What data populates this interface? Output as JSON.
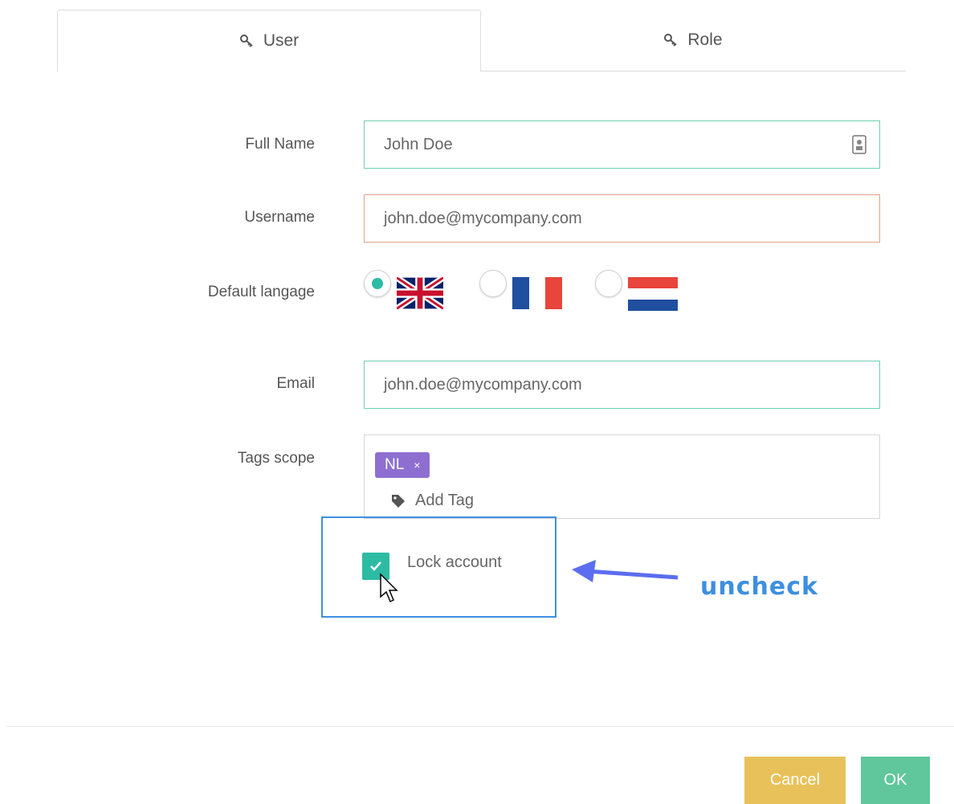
{
  "tabs": {
    "user": "User",
    "role": "Role"
  },
  "form": {
    "full_name_label": "Full Name",
    "full_name_value": "John Doe",
    "username_label": "Username",
    "username_value": "john.doe@mycompany.com",
    "language_label": "Default langage",
    "languages": [
      {
        "flag": "uk-flag",
        "selected": true
      },
      {
        "flag": "france-flag",
        "selected": false
      },
      {
        "flag": "netherlands-flag",
        "selected": false
      }
    ],
    "email_label": "Email",
    "email_value": "john.doe@mycompany.com",
    "tags_label": "Tags scope",
    "tags": [
      "NL"
    ],
    "tag_remove": "×",
    "add_tag": "Add Tag",
    "lock_account_label": "Lock account",
    "lock_account_checked": true
  },
  "annotation": {
    "text": "uncheck",
    "color": "#3d8fe0"
  },
  "buttons": {
    "cancel": "Cancel",
    "ok": "OK"
  },
  "colors": {
    "accent": "#2dbba4",
    "tag": "#8e6fd1",
    "cancel": "#e8c15a",
    "ok": "#5fc79b",
    "error_border": "#e0a28a"
  }
}
